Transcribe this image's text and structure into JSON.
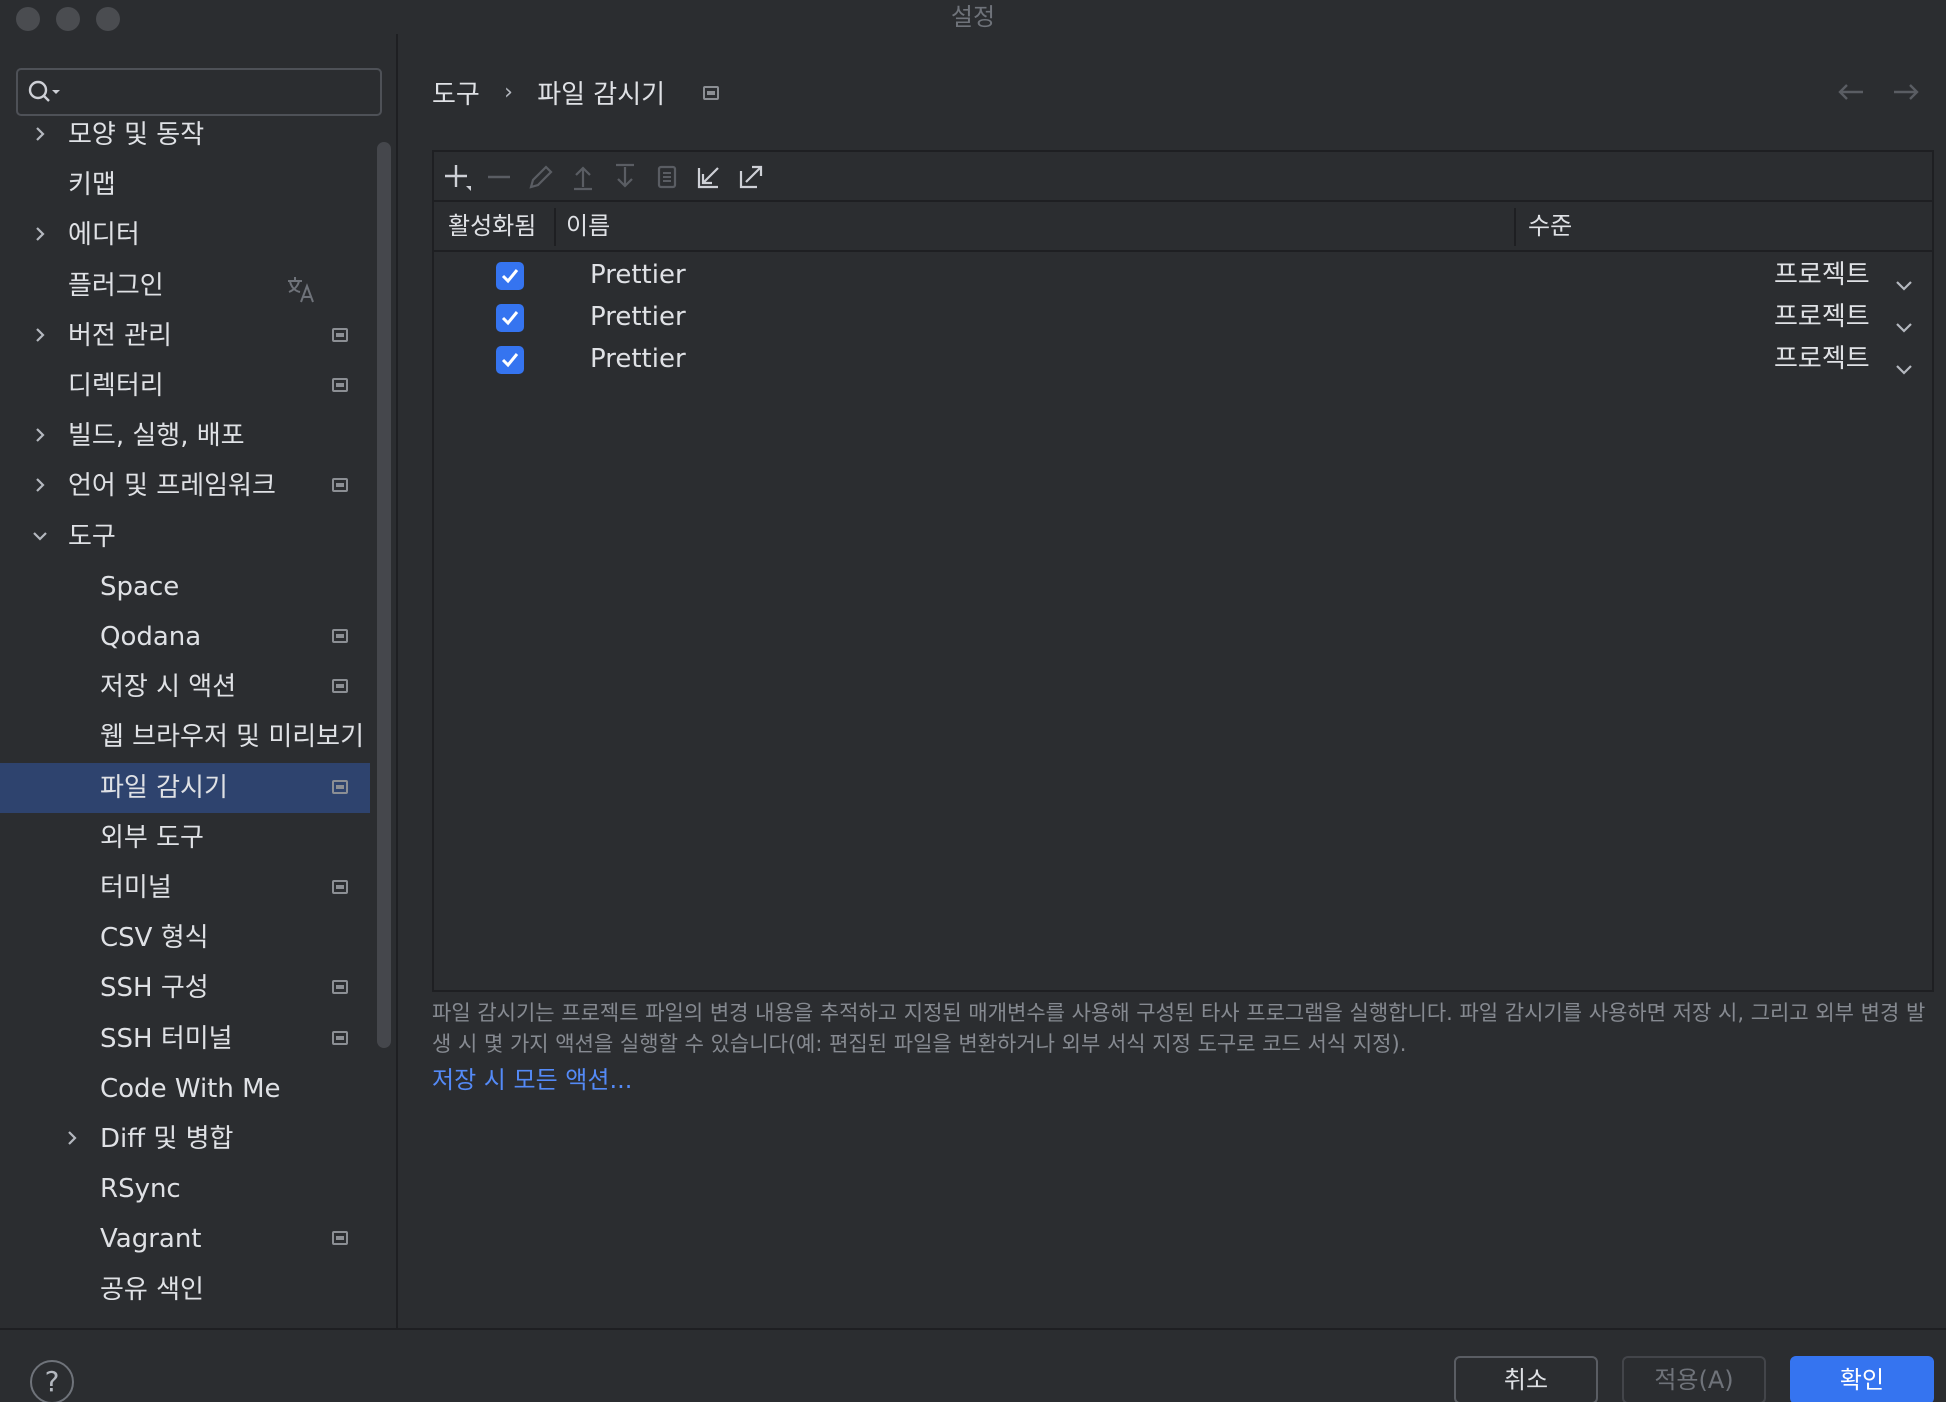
{
  "window": {
    "title": "설정"
  },
  "sidebar": {
    "search_placeholder": "",
    "items": [
      {
        "label": "모양 및 동작",
        "expandable": true,
        "expanded": false,
        "level": 0,
        "badge": false
      },
      {
        "label": "키맵",
        "expandable": false,
        "level": 0,
        "badge": false
      },
      {
        "label": "에디터",
        "expandable": true,
        "expanded": false,
        "level": 0,
        "badge": false
      },
      {
        "label": "플러그인",
        "expandable": false,
        "level": 0,
        "badge": false,
        "icon": "translate-icon"
      },
      {
        "label": "버전 관리",
        "expandable": true,
        "expanded": false,
        "level": 0,
        "badge": true
      },
      {
        "label": "디렉터리",
        "expandable": false,
        "level": 0,
        "badge": true
      },
      {
        "label": "빌드, 실행, 배포",
        "expandable": true,
        "expanded": false,
        "level": 0,
        "badge": false
      },
      {
        "label": "언어 및 프레임워크",
        "expandable": true,
        "expanded": false,
        "level": 0,
        "badge": true
      },
      {
        "label": "도구",
        "expandable": true,
        "expanded": true,
        "level": 0,
        "badge": false
      },
      {
        "label": "Space",
        "expandable": false,
        "level": 1,
        "badge": false
      },
      {
        "label": "Qodana",
        "expandable": false,
        "level": 1,
        "badge": true
      },
      {
        "label": "저장 시 액션",
        "expandable": false,
        "level": 1,
        "badge": true
      },
      {
        "label": "웹 브라우저 및 미리보기",
        "expandable": false,
        "level": 1,
        "badge": false
      },
      {
        "label": "파일 감시기",
        "expandable": false,
        "level": 1,
        "badge": true,
        "selected": true
      },
      {
        "label": "외부 도구",
        "expandable": false,
        "level": 1,
        "badge": false
      },
      {
        "label": "터미널",
        "expandable": false,
        "level": 1,
        "badge": true
      },
      {
        "label": "CSV 형식",
        "expandable": false,
        "level": 1,
        "badge": false
      },
      {
        "label": "SSH 구성",
        "expandable": false,
        "level": 1,
        "badge": true
      },
      {
        "label": "SSH 터미널",
        "expandable": false,
        "level": 1,
        "badge": true
      },
      {
        "label": "Code With Me",
        "expandable": false,
        "level": 1,
        "badge": false
      },
      {
        "label": "Diff 및 병합",
        "expandable": true,
        "expanded": false,
        "level": 1,
        "badge": false
      },
      {
        "label": "RSync",
        "expandable": false,
        "level": 1,
        "badge": false
      },
      {
        "label": "Vagrant",
        "expandable": false,
        "level": 1,
        "badge": true
      },
      {
        "label": "공유 색인",
        "expandable": false,
        "level": 1,
        "badge": false
      }
    ]
  },
  "breadcrumb": {
    "parent": "도구",
    "separator": "›",
    "current": "파일 감시기"
  },
  "toolbar": {
    "icons": [
      "add-icon",
      "remove-icon",
      "edit-icon",
      "move-up-icon",
      "move-down-icon",
      "copy-icon",
      "import-icon",
      "export-icon"
    ]
  },
  "table": {
    "columns": {
      "enabled": "활성화됨",
      "name": "이름",
      "level": "수준"
    },
    "rows": [
      {
        "enabled": true,
        "name": "Prettier",
        "level": "프로젝트"
      },
      {
        "enabled": true,
        "name": "Prettier",
        "level": "프로젝트"
      },
      {
        "enabled": true,
        "name": "Prettier",
        "level": "프로젝트"
      }
    ]
  },
  "description": "파일 감시기는 프로젝트 파일의 변경 내용을 추적하고 지정된 매개변수를 사용해 구성된 타사 프로그램을 실행합니다. 파일 감시기를 사용하면 저장 시, 그리고 외부 변경 발생 시 몇 가지 액션을 실행할 수 있습니다(예: 편집된 파일을 변환하거나 외부 서식 지정 도구로 코드 서식 지정).",
  "link": "저장 시 모든 액션...",
  "footer": {
    "help": "?",
    "cancel": "취소",
    "apply": "적용(A)",
    "ok": "확인"
  },
  "colors": {
    "accent": "#3574f0",
    "selection": "#2e436e",
    "link": "#548af7",
    "background": "#2b2d30"
  }
}
